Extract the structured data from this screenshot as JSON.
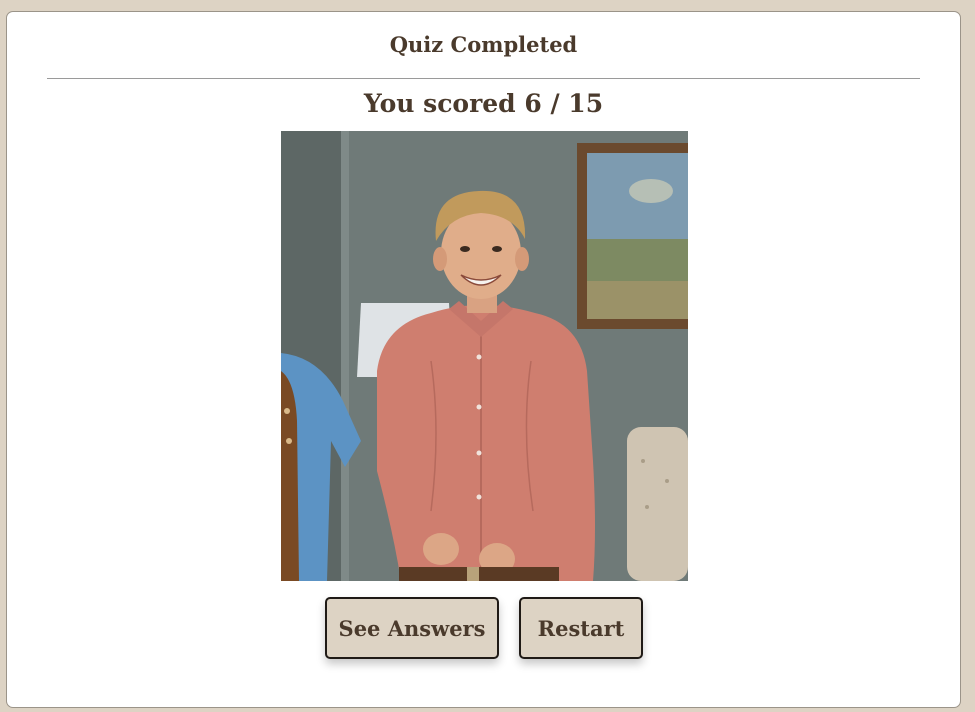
{
  "quiz": {
    "title": "Quiz Completed",
    "score_text": "You scored 6 / 15"
  },
  "buttons": {
    "see_answers_label": "See Answers",
    "restart_label": "Restart"
  },
  "colors": {
    "page_background": "#ddd3c4",
    "text": "#4a3a2c",
    "button_background": "#ddd3c4"
  }
}
